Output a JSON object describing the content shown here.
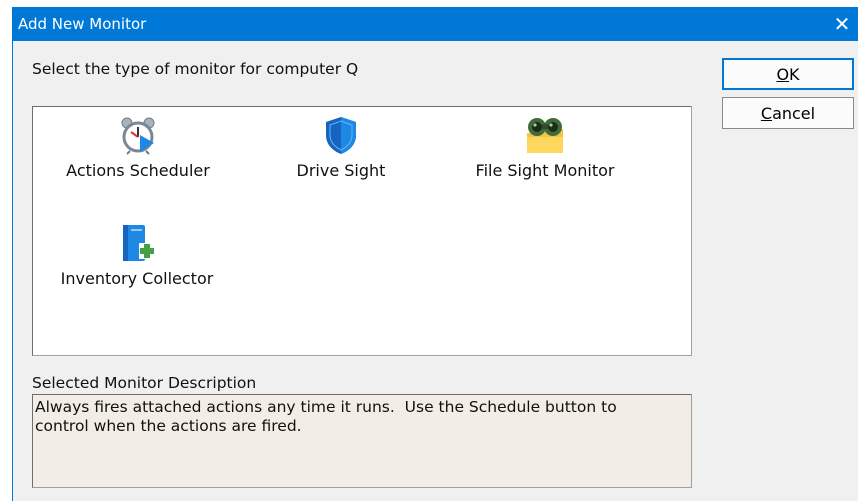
{
  "window": {
    "title": "Add New Monitor",
    "close_glyph": "✕",
    "titlebar_color": "#0078d7"
  },
  "prompt": "Select the type of monitor for computer Q",
  "buttons": {
    "ok": {
      "mnemonic": "O",
      "rest": "K"
    },
    "cancel": {
      "mnemonic": "C",
      "rest": "ancel"
    }
  },
  "monitors": [
    {
      "label": "Actions Scheduler",
      "icon": "alarm-clock-play-icon"
    },
    {
      "label": "Drive Sight",
      "icon": "shield-icon"
    },
    {
      "label": "File Sight Monitor",
      "icon": "binoculars-folder-icon"
    },
    {
      "label": "Inventory Collector",
      "icon": "book-plus-icon"
    }
  ],
  "description": {
    "label": "Selected Monitor Description",
    "text": "Always fires attached actions any time it runs.  Use the Schedule button to\ncontrol when the actions are fired."
  }
}
